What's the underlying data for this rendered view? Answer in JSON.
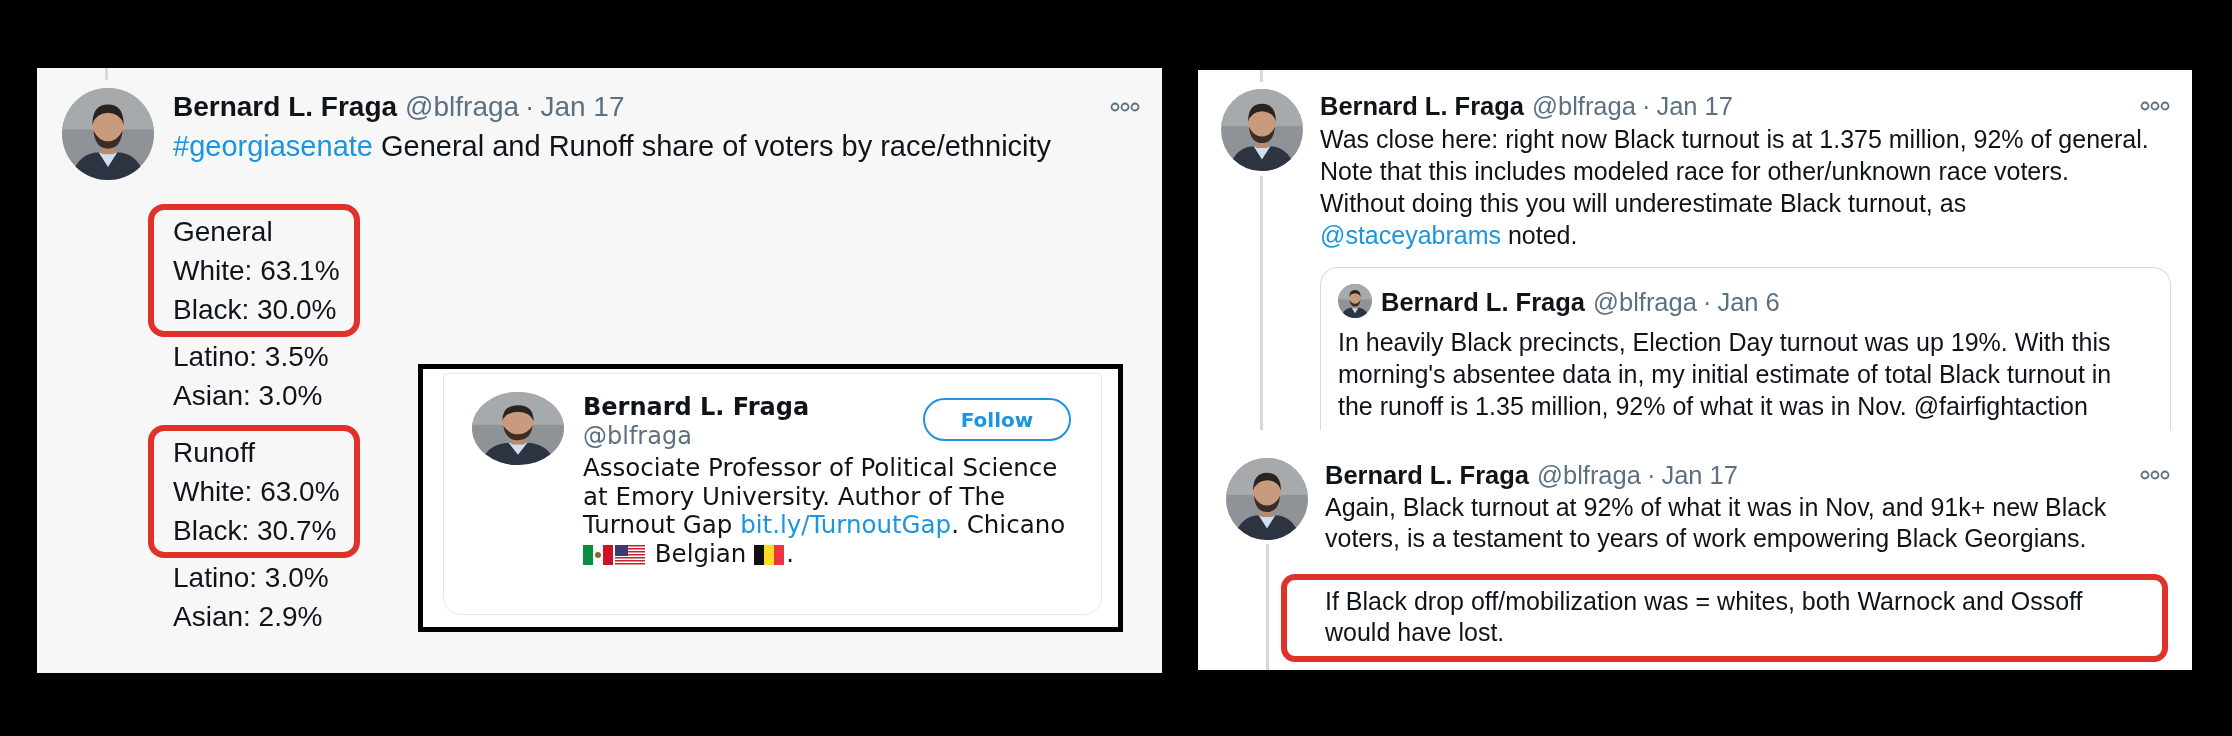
{
  "left_panel": {
    "tweet": {
      "author": {
        "name": "Bernard L. Fraga",
        "handle": "@blfraga",
        "dot": "·",
        "date": "Jan 17"
      },
      "text": [
        {
          "kind": "hashtag",
          "text": "#georgiasenate"
        },
        {
          "kind": "plain",
          "text": " General and Runoff share of voters by race/ethnicity"
        }
      ]
    },
    "groups": [
      {
        "boxed": [
          "General",
          "White: 63.1%",
          "Black: 30.0%"
        ],
        "rest": [
          "Latino: 3.5%",
          "Asian: 3.0%"
        ]
      },
      {
        "boxed": [
          "Runoff",
          "White: 63.0%",
          "Black: 30.7%"
        ],
        "rest": [
          "Latino: 3.0%",
          "Asian: 2.9%"
        ]
      }
    ],
    "profile_card": {
      "name": "Bernard L. Fraga",
      "handle": "@blfraga",
      "follow_button": "Follow",
      "bio": [
        {
          "kind": "text",
          "text": "Associate Professor of Political Science at Emory University. Author of The Turnout Gap "
        },
        {
          "kind": "link",
          "text": "bit.ly/TurnoutGap"
        },
        {
          "kind": "text",
          "text": ". Chicano "
        },
        {
          "kind": "flag-mexico"
        },
        {
          "kind": "flag-usa"
        },
        {
          "kind": "text",
          "text": " Belgian "
        },
        {
          "kind": "flag-belgium"
        },
        {
          "kind": "text",
          "text": "."
        }
      ]
    }
  },
  "right_panel": {
    "tweets": [
      {
        "author": {
          "name": "Bernard L. Fraga",
          "handle": "@blfraga",
          "dot": "·",
          "date": "Jan 17"
        },
        "paragraphs": [
          {
            "boxed": false,
            "text": [
              {
                "kind": "plain",
                "text": "Was close here: right now Black turnout is at 1.375 million, 92% of general.\nNote that this includes modeled race for other/unknown race voters.\nWithout doing this you will underestimate Black turnout, as\n"
              },
              {
                "kind": "mention",
                "text": "@staceyabrams"
              },
              {
                "kind": "plain",
                "text": " noted."
              }
            ]
          }
        ],
        "quote": {
          "author": {
            "name": "Bernard L. Fraga",
            "handle": "@blfraga",
            "dot": "·",
            "date": "Jan 6"
          },
          "text": "In heavily Black precincts, Election Day turnout was up 19%. With this\nmorning's absentee data in, my initial estimate of total Black turnout in\nthe runoff is 1.35 million, 92% of what it was in Nov. @fairfightaction"
        }
      },
      {
        "author": {
          "name": "Bernard L. Fraga",
          "handle": "@blfraga",
          "dot": "·",
          "date": "Jan 17"
        },
        "paragraphs": [
          {
            "boxed": false,
            "text": [
              {
                "kind": "plain",
                "text": "Again, Black turnout at 92% of what it was in Nov, and 91k+ new Black\nvoters, is a testament to years of work empowering Black Georgians."
              }
            ]
          },
          {
            "boxed": true,
            "text": [
              {
                "kind": "plain",
                "text": "If Black drop off/mobilization was = whites, both Warnock and Ossoff\nwould have lost."
              }
            ]
          }
        ]
      }
    ]
  }
}
